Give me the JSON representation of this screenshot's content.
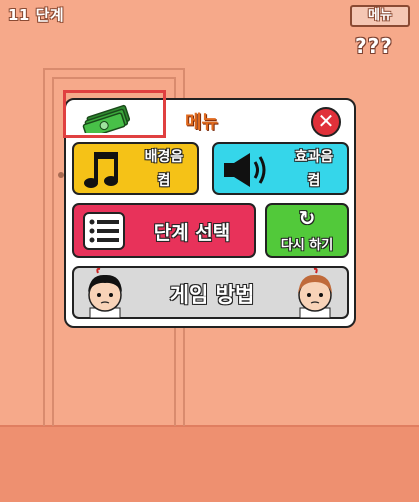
{
  "hud": {
    "level_label": "11 단계",
    "menu_button": "메뉴",
    "hint_text": "???"
  },
  "dialog": {
    "title": "메뉴",
    "close_symbol": "✕",
    "buttons": {
      "bgm_line1": "배경음",
      "bgm_line2": "켬",
      "sfx_line1": "효과음",
      "sfx_line2": "켬",
      "stage_select": "단계 선택",
      "retry_symbol": "↻",
      "retry": "다시 하기",
      "how_to_play": "게임 방법"
    }
  },
  "colors": {
    "wall": "#f6a98a",
    "floor": "#ee9070",
    "bgm": "#f5c217",
    "sfx": "#35d6ea",
    "stage": "#e8325a",
    "retry": "#52c93a",
    "howto": "#d9d9d9",
    "highlight": "#e04040"
  },
  "icons": [
    "money-icon",
    "close-icon",
    "music-note-icon",
    "speaker-icon",
    "list-icon",
    "refresh-icon",
    "boy-face-icon",
    "girl-face-icon"
  ]
}
